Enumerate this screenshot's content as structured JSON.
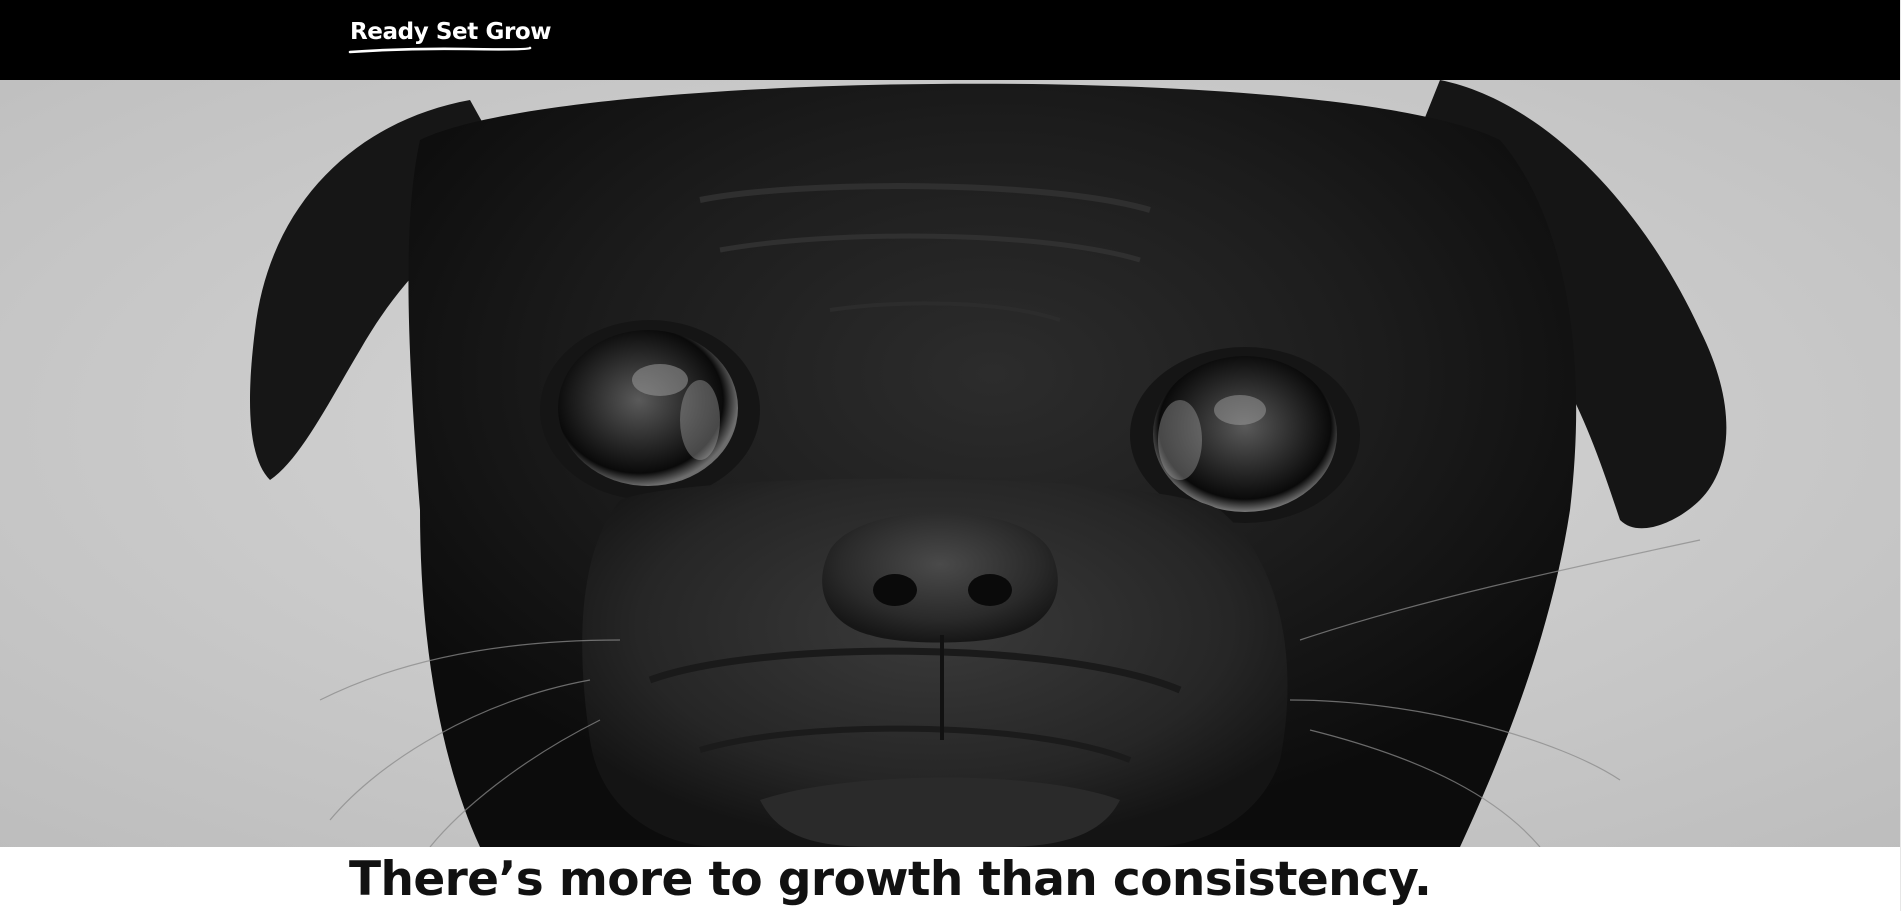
{
  "header": {
    "logo_text": "Ready Set Grow",
    "background": "#000000",
    "logo_color": "#ffffff"
  },
  "hero": {
    "image_subject": "black pug close-up portrait, grayscale",
    "background_color": "#cfcfcf"
  },
  "main": {
    "headline": "There’s more to growth than consistency."
  }
}
